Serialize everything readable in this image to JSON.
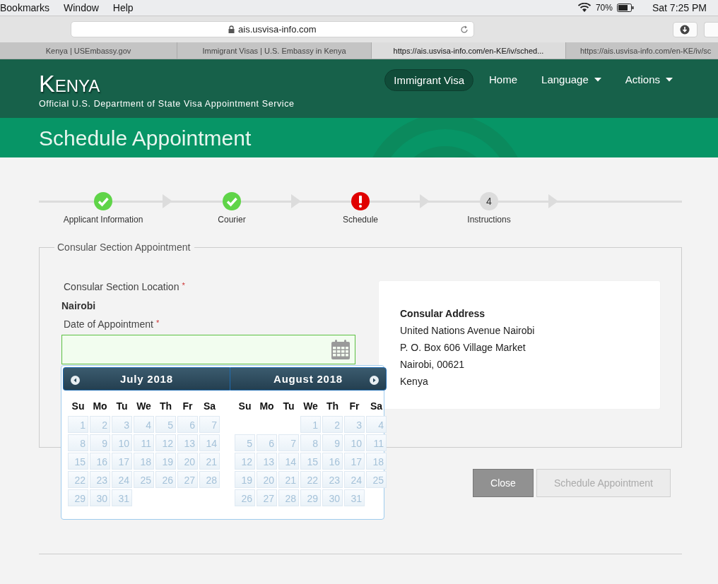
{
  "menu_bar": {
    "items": [
      "Bookmarks",
      "Window",
      "Help"
    ],
    "battery": "70%",
    "clock": "Sat 7:25 PM"
  },
  "toolbar": {
    "address": "ais.usvisa-info.com"
  },
  "tabs": [
    {
      "label": "Kenya | USEmbassy.gov",
      "selected": false
    },
    {
      "label": "Immigrant Visas | U.S. Embassy in Kenya",
      "selected": false
    },
    {
      "label": "https://ais.usvisa-info.com/en-KE/iv/sched...",
      "selected": true
    },
    {
      "label": "https://ais.usvisa-info.com/en-KE/iv/sc",
      "selected": false
    }
  ],
  "header": {
    "title": "Kenya",
    "subtitle": "Official U.S. Department of State Visa Appointment Service",
    "nav": [
      {
        "label": "Immigrant Visa",
        "selected": true,
        "dropdown": false
      },
      {
        "label": "Home",
        "selected": false,
        "dropdown": false
      },
      {
        "label": "Language",
        "selected": false,
        "dropdown": true
      },
      {
        "label": "Actions",
        "selected": false,
        "dropdown": true
      }
    ]
  },
  "page_title": "Schedule Appointment",
  "steps": [
    {
      "label": "Applicant Information",
      "kind": "done"
    },
    {
      "label": "Courier",
      "kind": "done"
    },
    {
      "label": "Schedule",
      "kind": "error"
    },
    {
      "label": "Instructions",
      "kind": "pending",
      "number": "4"
    }
  ],
  "form": {
    "legend": "Consular Section Appointment",
    "location_label": "Consular Section Location",
    "location_required_mark": "*",
    "location_value": "Nairobi",
    "date_label": "Date of Appointment",
    "date_required_mark": "*",
    "address": {
      "title": "Consular Address",
      "lines": [
        "United Nations Avenue Nairobi",
        "P. O. Box 606 Village Market",
        "Nairobi, 00621",
        "Kenya"
      ]
    }
  },
  "datepicker": {
    "days_disabled": true,
    "months": [
      {
        "title": "July 2018",
        "prev_button": true,
        "weekdays": [
          "Su",
          "Mo",
          "Tu",
          "We",
          "Th",
          "Fr",
          "Sa"
        ],
        "weeks": [
          {
            "days": [
              "1",
              "2",
              "3",
              "4",
              "5",
              "6",
              "7"
            ]
          },
          {
            "days": [
              "8",
              "9",
              "10",
              "11",
              "12",
              "13",
              "14"
            ]
          },
          {
            "days": [
              "15",
              "16",
              "17",
              "18",
              "19",
              "20",
              "21"
            ]
          },
          {
            "days": [
              "22",
              "23",
              "24",
              "25",
              "26",
              "27",
              "28"
            ]
          },
          {
            "days": [
              "29",
              "30",
              "31"
            ]
          }
        ]
      },
      {
        "title": "August 2018",
        "next_button": true,
        "weekdays": [
          "Su",
          "Mo",
          "Tu",
          "We",
          "Th",
          "Fr",
          "Sa"
        ],
        "weeks": [
          {
            "starts_midweek": true,
            "days": [
              "1",
              "2",
              "3",
              "4"
            ]
          },
          {
            "days": [
              "5",
              "6",
              "7",
              "8",
              "9",
              "10",
              "11"
            ]
          },
          {
            "days": [
              "12",
              "13",
              "14",
              "15",
              "16",
              "17",
              "18"
            ]
          },
          {
            "days": [
              "19",
              "20",
              "21",
              "22",
              "23",
              "24",
              "25"
            ]
          },
          {
            "days": [
              "26",
              "27",
              "28",
              "29",
              "30",
              "31"
            ]
          }
        ]
      }
    ]
  },
  "buttons": [
    {
      "label": "Close",
      "disabled": false
    },
    {
      "label": "Schedule Appointment",
      "disabled": true
    }
  ]
}
